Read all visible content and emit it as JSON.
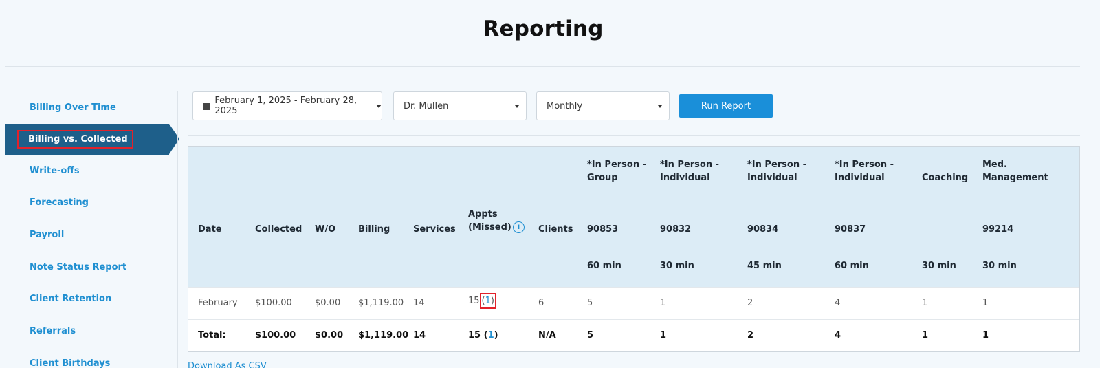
{
  "page": {
    "title": "Reporting"
  },
  "sidebar": {
    "items": [
      {
        "label": "Billing Over Time"
      },
      {
        "label": "Billing vs. Collected"
      },
      {
        "label": "Write-offs"
      },
      {
        "label": "Forecasting"
      },
      {
        "label": "Payroll"
      },
      {
        "label": "Note Status Report"
      },
      {
        "label": "Client Retention"
      },
      {
        "label": "Referrals"
      },
      {
        "label": "Client Birthdays"
      }
    ],
    "active_index": 1
  },
  "filters": {
    "date_range": "February 1, 2025 - February 28, 2025",
    "provider": "Dr. Mullen",
    "period": "Monthly",
    "run_label": "Run Report"
  },
  "table": {
    "headers": {
      "date": "Date",
      "collected": "Collected",
      "wo": "W/O",
      "billing": "Billing",
      "services": "Services",
      "appts_line1": "Appts",
      "appts_line2": "(Missed)",
      "clients": "Clients",
      "svc": [
        {
          "name1": "*In Person -",
          "name2": "Group",
          "code": "90853",
          "duration": "60 min"
        },
        {
          "name1": "*In Person -",
          "name2": "Individual",
          "code": "90832",
          "duration": "30 min"
        },
        {
          "name1": "*In Person -",
          "name2": "Individual",
          "code": "90834",
          "duration": "45 min"
        },
        {
          "name1": "*In Person -",
          "name2": "Individual",
          "code": "90837",
          "duration": "60 min"
        },
        {
          "name1": "",
          "name2": "Coaching",
          "code": "",
          "duration": "30 min"
        },
        {
          "name1": "Med.",
          "name2": "Management",
          "code": "99214",
          "duration": "30 min"
        }
      ]
    },
    "rows": [
      {
        "date": "February",
        "collected": "$100.00",
        "wo": "$0.00",
        "billing": "$1,119.00",
        "services": "14",
        "appts": "15",
        "missed": "1",
        "clients": "6",
        "svc": [
          "5",
          "1",
          "2",
          "4",
          "1",
          "1"
        ]
      }
    ],
    "total": {
      "date": "Total:",
      "collected": "$100.00",
      "wo": "$0.00",
      "billing": "$1,119.00",
      "services": "14",
      "appts": "15",
      "missed": "1",
      "clients": "N/A",
      "svc": [
        "5",
        "1",
        "2",
        "4",
        "1",
        "1"
      ]
    }
  },
  "download_label": "Download As CSV",
  "colors": {
    "accent": "#1f8fd1",
    "active_bg": "#1e5f8a",
    "highlight": "#e2222b",
    "header_bg": "#dcecf6"
  }
}
